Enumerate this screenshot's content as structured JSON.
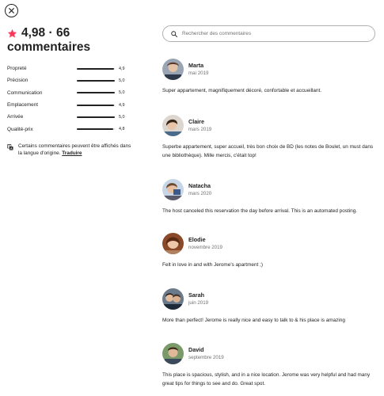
{
  "header": {
    "rating": "4,98",
    "separator": "·",
    "count": "66",
    "reviews_word": "commentaires",
    "accent_color": "#ff385c"
  },
  "categories": [
    {
      "label": "Propreté",
      "score": "4,9",
      "value": 4.9
    },
    {
      "label": "Précision",
      "score": "5,0",
      "value": 5.0
    },
    {
      "label": "Communication",
      "score": "5,0",
      "value": 5.0
    },
    {
      "label": "Emplacement",
      "score": "4,9",
      "value": 4.9
    },
    {
      "label": "Arrivée",
      "score": "5,0",
      "value": 5.0
    },
    {
      "label": "Qualité-prix",
      "score": "4,8",
      "value": 4.8
    }
  ],
  "translation": {
    "note": "Certains commentaires peuvent être affichés dans la langue d'origine.",
    "link": "Traduire"
  },
  "search": {
    "placeholder": "Rechercher des commentaires"
  },
  "reviews": [
    {
      "name": "Marta",
      "date": "mai 2019",
      "text": "Super appartement, magnifiquement décoré, confortable et accueillant."
    },
    {
      "name": "Claire",
      "date": "mars 2019",
      "text": "Superbe appartement, super accueil, très bon choix de BD (les notes de Boulet, un must dans une bibliothèque). Mille mercis, c'était top!"
    },
    {
      "name": "Natacha",
      "date": "mars 2020",
      "text": "The host canceled this reservation the day before arrival. This is an automated posting."
    },
    {
      "name": "Elodie",
      "date": "novembre 2019",
      "text": "Felt in love in and with Jerome's apartment ;)"
    },
    {
      "name": "Sarah",
      "date": "juin 2019",
      "text": "More than perfect! Jerome is really nice and easy to talk to & his place is amazing"
    },
    {
      "name": "David",
      "date": "septembre 2019",
      "text": "This place is spacious, stylish, and in a nice location. Jerome was very helpful and had many great tips for things to see and do. Great spot."
    }
  ]
}
